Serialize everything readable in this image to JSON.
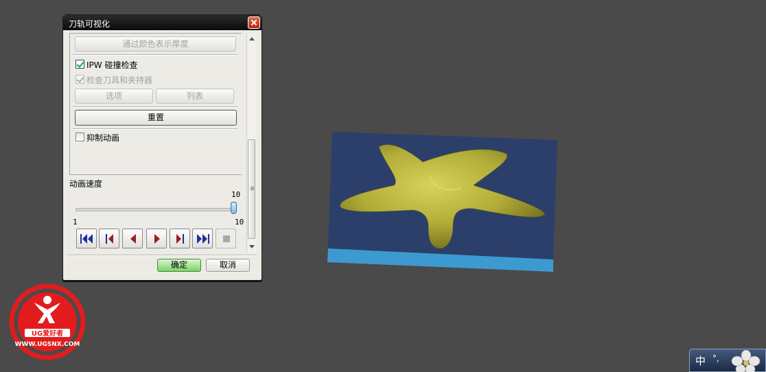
{
  "dialog": {
    "title": "刀轨可视化",
    "thickness_button": "通过颜色表示厚度",
    "ipw_check_label": "IPW 碰撞检查",
    "ipw_checked": true,
    "tool_check_label": "检查刀具和夹持器",
    "tool_checked": true,
    "options_button": "选项",
    "list_button": "列表",
    "reset_button": "重置",
    "suppress_label": "抑制动画",
    "suppress_checked": false,
    "speed_label": "动画速度",
    "speed_current": "10",
    "speed_min": "1",
    "speed_max": "10",
    "speed_value": 10,
    "ok_button": "确定",
    "cancel_button": "取消"
  },
  "playback_icons": [
    "skip-to-start-icon",
    "step-back-icon",
    "play-reverse-icon",
    "play-forward-icon",
    "step-forward-icon",
    "skip-to-end-icon",
    "stop-icon"
  ],
  "logo": {
    "brand": "UG爱好者",
    "url": "WWW.UGSNX.COM"
  },
  "ime": {
    "mode": "中"
  },
  "colors": {
    "background": "#4a4a4a",
    "stock_top": "#2b3f6a",
    "stock_side": "#3d9ad0",
    "part": "#b9b43c",
    "logo_red": "#e21c1c"
  }
}
